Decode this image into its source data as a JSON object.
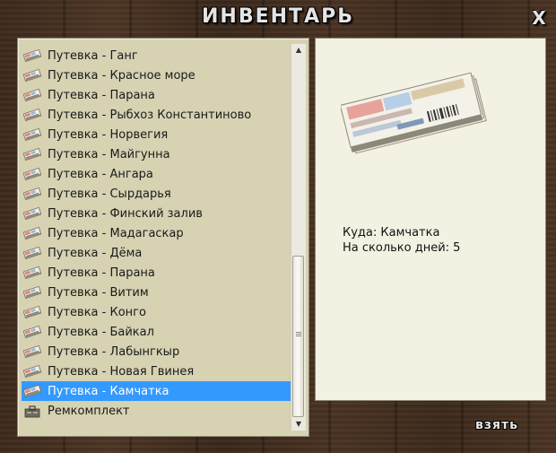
{
  "window": {
    "title": "ИНВЕНТАРЬ",
    "close_label": "X"
  },
  "list": {
    "items": [
      {
        "label": "Путевка - Ганг",
        "icon": "ticket-icon"
      },
      {
        "label": "Путевка - Красное море",
        "icon": "ticket-icon"
      },
      {
        "label": "Путевка - Парана",
        "icon": "ticket-icon"
      },
      {
        "label": "Путевка - Рыбхоз Константиново",
        "icon": "ticket-icon"
      },
      {
        "label": "Путевка - Норвегия",
        "icon": "ticket-icon"
      },
      {
        "label": "Путевка - Майгунна",
        "icon": "ticket-icon"
      },
      {
        "label": "Путевка - Ангара",
        "icon": "ticket-icon"
      },
      {
        "label": "Путевка - Сырдарья",
        "icon": "ticket-icon"
      },
      {
        "label": "Путевка - Финский залив",
        "icon": "ticket-icon"
      },
      {
        "label": "Путевка - Мадагаскар",
        "icon": "ticket-icon"
      },
      {
        "label": "Путевка - Дёма",
        "icon": "ticket-icon"
      },
      {
        "label": "Путевка - Парана",
        "icon": "ticket-icon"
      },
      {
        "label": "Путевка - Витим",
        "icon": "ticket-icon"
      },
      {
        "label": "Путевка - Конго",
        "icon": "ticket-icon"
      },
      {
        "label": "Путевка - Байкал",
        "icon": "ticket-icon"
      },
      {
        "label": "Путевка - Лабынгкыр",
        "icon": "ticket-icon"
      },
      {
        "label": "Путевка - Новая Гвинея",
        "icon": "ticket-icon"
      },
      {
        "label": "Путевка - Камчатка",
        "icon": "ticket-icon",
        "selected": true
      },
      {
        "label": "Ремкомплект",
        "icon": "repair-kit-icon"
      }
    ]
  },
  "detail": {
    "image_icon": "ticket-stack-icon",
    "line1": "Куда: Камчатка",
    "line2": "На сколько дней: 5"
  },
  "footer": {
    "take_label": "взять"
  },
  "colors": {
    "selection": "#3399ff",
    "list_bg": "#d6d2b2",
    "detail_bg": "#f3f2e2"
  }
}
